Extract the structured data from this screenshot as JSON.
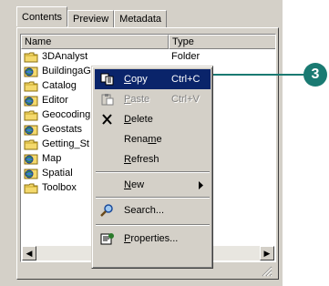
{
  "tabs": [
    {
      "label": "Contents",
      "active": true
    },
    {
      "label": "Preview",
      "active": false
    },
    {
      "label": "Metadata",
      "active": false
    }
  ],
  "columns": {
    "name": "Name",
    "type": "Type"
  },
  "rows": [
    {
      "name": "3DAnalyst",
      "type": "Folder",
      "icon": "folder-icon"
    },
    {
      "name": "BuildingaG",
      "type": "",
      "icon": "geodatabase-icon"
    },
    {
      "name": "Catalog",
      "type": "",
      "icon": "folder-icon"
    },
    {
      "name": "Editor",
      "type": "",
      "icon": "geodatabase-icon"
    },
    {
      "name": "Geocoding",
      "type": "",
      "icon": "folder-icon"
    },
    {
      "name": "Geostats",
      "type": "",
      "icon": "geodatabase-icon"
    },
    {
      "name": "Getting_St",
      "type": "",
      "icon": "folder-icon"
    },
    {
      "name": "Map",
      "type": "",
      "icon": "geodatabase-icon"
    },
    {
      "name": "Spatial",
      "type": "",
      "icon": "geodatabase-icon"
    },
    {
      "name": "Toolbox",
      "type": "",
      "icon": "folder-icon"
    }
  ],
  "menu": {
    "copy": {
      "label_pre": "",
      "label_u": "C",
      "label_post": "opy",
      "shortcut": "Ctrl+C",
      "icon": "copy-icon",
      "highlighted": true
    },
    "paste": {
      "label_pre": "",
      "label_u": "P",
      "label_post": "aste",
      "shortcut": "Ctrl+V",
      "icon": "paste-icon",
      "disabled": true
    },
    "delete": {
      "label_pre": "",
      "label_u": "D",
      "label_post": "elete",
      "icon": "delete-icon"
    },
    "rename": {
      "label_pre": "Rena",
      "label_u": "m",
      "label_post": "e"
    },
    "refresh": {
      "label_pre": "",
      "label_u": "R",
      "label_post": "efresh"
    },
    "new": {
      "label_pre": "",
      "label_u": "N",
      "label_post": "ew",
      "submenu": true
    },
    "search": {
      "label": "Search...",
      "icon": "search-icon"
    },
    "properties": {
      "label_pre": "",
      "label_u": "P",
      "label_post": "roperties...",
      "icon": "properties-icon"
    }
  },
  "callout": {
    "number": "3",
    "color": "#1a7a72"
  },
  "colors": {
    "highlight": "#0a246a",
    "window": "#d4d0c8",
    "folder": "#f4d96c"
  }
}
